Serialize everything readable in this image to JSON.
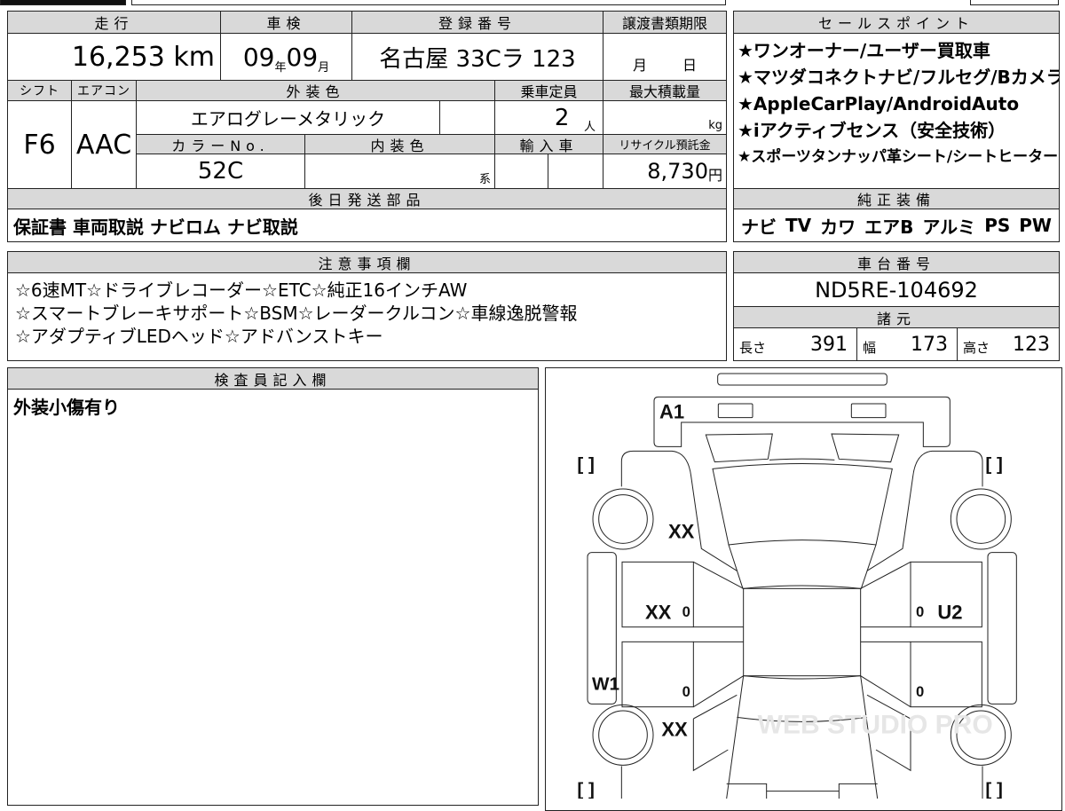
{
  "header": {
    "mileage": "走行",
    "inspection": "車検",
    "registration": "登録番号",
    "transfer_deadline": "譲渡書類期限",
    "shift": "シフト",
    "aircon": "エアコン",
    "exterior_color": "外装色",
    "capacity": "乗車定員",
    "max_load": "最大積載量",
    "color_no": "カラーNo.",
    "interior_color": "内装色",
    "imported": "輸入車",
    "recycle_fee": "リサイクル預託金",
    "later_parts": "後日発送部品",
    "sales_points": "セールスポイント",
    "standard_equipment": "純正装備",
    "notes": "注意事項欄",
    "chassis_no": "車台番号",
    "specs": "諸元",
    "inspector": "検査員記入欄"
  },
  "values": {
    "mileage": "16,253",
    "mileage_unit": "km",
    "inspection_year": "09",
    "year_unit": "年",
    "inspection_month": "09",
    "month_unit": "月",
    "registration": "名古屋 33Cラ 123",
    "deadline_month": "月",
    "deadline_day": "日",
    "shift": "F6",
    "aircon": "AAC",
    "exterior_color": "エアログレーメタリック",
    "capacity": "2",
    "capacity_unit": "人",
    "load_unit": "kg",
    "color_no": "52C",
    "interior_suffix": "系",
    "recycle_fee": "8,730",
    "recycle_unit": "円",
    "later_parts": "保証書 車両取説 ナビロム ナビ取説",
    "chassis_no": "ND5RE-104692",
    "length_label": "長さ",
    "length": "391",
    "width_label": "幅",
    "width": "173",
    "height_label": "高さ",
    "height": "123",
    "inspector_note": "外装小傷有り"
  },
  "sales_points": [
    "★ワンオーナー/ユーザー買取車",
    "★マツダコネクトナビ/フルセグ/Bカメラ",
    "★AppleCarPlay/AndroidAuto",
    "★iアクティブセンス（安全技術）",
    "★スポーツタンナッパ革シート/シートヒーター"
  ],
  "standard_equipment": [
    "ナビ",
    "TV",
    "カワ",
    "エアB",
    "アルミ",
    "PS",
    "PW"
  ],
  "notes": [
    "☆6速MT☆ドライブレコーダー☆ETC☆純正16インチAW",
    "☆スマートブレーキサポート☆BSM☆レーダークルコン☆車線逸脱警報",
    "☆アダプティブLEDヘッド☆アドバンストキー"
  ],
  "diagram": {
    "labels": {
      "a1": "A1",
      "xx_front": "XX",
      "xx_door": "XX",
      "u2": "U2",
      "w1": "W1",
      "xx_rear": "XX",
      "zero": "0"
    },
    "bracket": "[      ]",
    "watermark": "WEB STUDIO PRO"
  }
}
